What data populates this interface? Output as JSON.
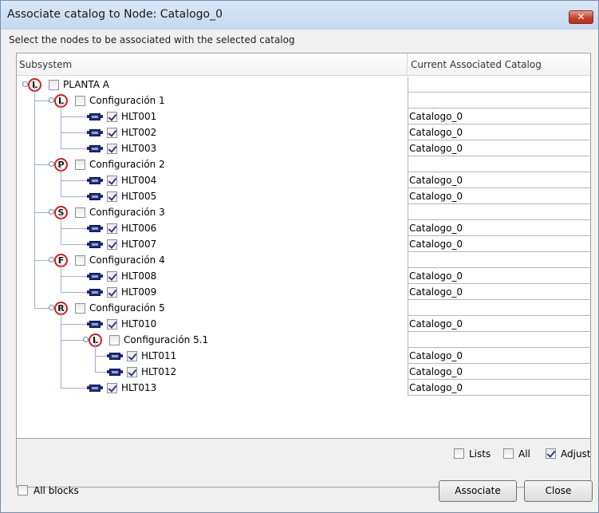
{
  "window": {
    "title": "Associate catalog to Node: Catalogo_0",
    "close_glyph": "✕",
    "instruction": "Select the nodes to be associated with the selected catalog"
  },
  "grid": {
    "headers": {
      "subsystem": "Subsystem",
      "catalog": "Current Associated Catalog"
    },
    "rows": [
      {
        "label": "PLANTA A",
        "catalog": "",
        "icon": "L",
        "checked": false,
        "level": 0
      },
      {
        "label": "Configuración 1",
        "catalog": "",
        "icon": "L",
        "checked": false,
        "level": 1
      },
      {
        "label": "HLT001",
        "catalog": "Catalogo_0",
        "icon": "block",
        "checked": true,
        "level": 2
      },
      {
        "label": "HLT002",
        "catalog": "Catalogo_0",
        "icon": "block",
        "checked": true,
        "level": 2
      },
      {
        "label": "HLT003",
        "catalog": "Catalogo_0",
        "icon": "block",
        "checked": true,
        "level": 2
      },
      {
        "label": "Configuración 2",
        "catalog": "",
        "icon": "P",
        "checked": false,
        "level": 1
      },
      {
        "label": "HLT004",
        "catalog": "Catalogo_0",
        "icon": "block",
        "checked": true,
        "level": 2
      },
      {
        "label": "HLT005",
        "catalog": "Catalogo_0",
        "icon": "block",
        "checked": true,
        "level": 2
      },
      {
        "label": "Configuración 3",
        "catalog": "",
        "icon": "S",
        "checked": false,
        "level": 1
      },
      {
        "label": "HLT006",
        "catalog": "Catalogo_0",
        "icon": "block",
        "checked": true,
        "level": 2
      },
      {
        "label": "HLT007",
        "catalog": "Catalogo_0",
        "icon": "block",
        "checked": true,
        "level": 2
      },
      {
        "label": "Configuración 4",
        "catalog": "",
        "icon": "F",
        "checked": false,
        "level": 1
      },
      {
        "label": "HLT008",
        "catalog": "Catalogo_0",
        "icon": "block",
        "checked": true,
        "level": 2
      },
      {
        "label": "HLT009",
        "catalog": "Catalogo_0",
        "icon": "block",
        "checked": true,
        "level": 2
      },
      {
        "label": "Configuración 5",
        "catalog": "",
        "icon": "R",
        "checked": false,
        "level": 1
      },
      {
        "label": "HLT010",
        "catalog": "Catalogo_0",
        "icon": "block",
        "checked": true,
        "level": 2
      },
      {
        "label": "Configuración 5.1",
        "catalog": "",
        "icon": "L",
        "checked": false,
        "level": 2
      },
      {
        "label": "HLT011",
        "catalog": "Catalogo_0",
        "icon": "block",
        "checked": true,
        "level": 3
      },
      {
        "label": "HLT012",
        "catalog": "Catalogo_0",
        "icon": "block",
        "checked": true,
        "level": 3
      },
      {
        "label": "HLT013",
        "catalog": "Catalogo_0",
        "icon": "block",
        "checked": true,
        "level": 2
      }
    ]
  },
  "options": {
    "lists": {
      "label": "Lists",
      "checked": false
    },
    "all": {
      "label": "All",
      "checked": false
    },
    "adjust": {
      "label": "Adjust",
      "checked": true
    }
  },
  "footer": {
    "all_blocks": {
      "label": "All blocks",
      "checked": false
    },
    "associate_label": "Associate",
    "close_label": "Close"
  },
  "colors": {
    "accent_red": "#d02020",
    "block_blue": "#1e2f7a"
  }
}
